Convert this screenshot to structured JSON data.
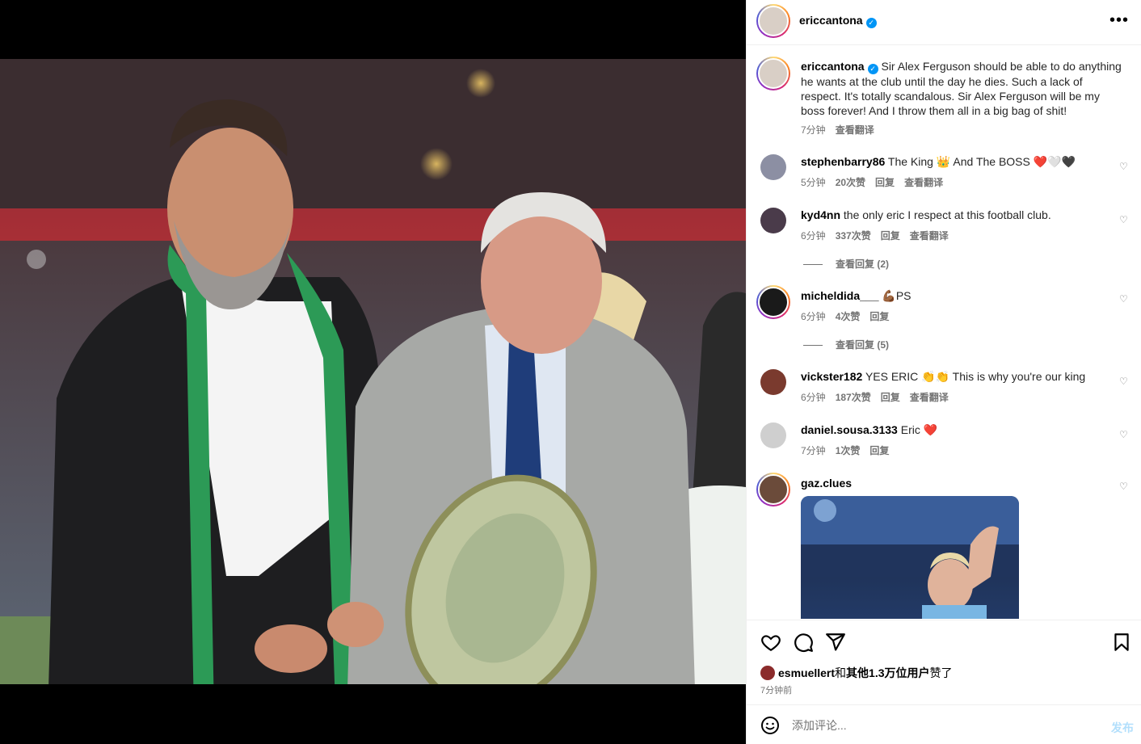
{
  "header": {
    "username": "ericcantona",
    "more_label": "•••"
  },
  "caption": {
    "username": "ericcantona",
    "text": "Sir Alex Ferguson should be able to do anything he wants at the club until the day he dies. Such a lack of respect. It's totally scandalous. Sir Alex Ferguson will be my boss forever! And I throw them all in a big bag of shit!",
    "time": "7分钟",
    "translate": "查看翻译"
  },
  "comments": [
    {
      "username": "stephenbarry86",
      "text": "The King 👑 And The BOSS ❤️🤍🖤",
      "time": "5分钟",
      "likes": "20次赞",
      "reply": "回复",
      "translate": "查看翻译"
    },
    {
      "username": "kyd4nn",
      "text": "the only eric I respect at this football club.",
      "time": "6分钟",
      "likes": "337次赞",
      "reply": "回复",
      "translate": "查看翻译",
      "view_replies": "查看回复 (2)"
    },
    {
      "username": "micheldida___",
      "text": "💪🏾PS",
      "time": "6分钟",
      "likes": "4次赞",
      "reply": "回复",
      "view_replies": "查看回复 (5)"
    },
    {
      "username": "vickster182",
      "text": "YES ERIC 👏👏 This is why you're our king",
      "time": "6分钟",
      "likes": "187次赞",
      "reply": "回复",
      "translate": "查看翻译"
    },
    {
      "username": "daniel.sousa.3133",
      "text": "Eric ❤️",
      "time": "7分钟",
      "likes": "1次赞",
      "reply": "回复"
    },
    {
      "username": "gaz.clues",
      "text": ""
    }
  ],
  "likes_line": {
    "user": "esmuellert",
    "and": "和",
    "others": "其他1.3万位用户",
    "suffix": "赞了"
  },
  "post_time": "7分钟前",
  "comment_box": {
    "placeholder": "添加评论...",
    "post_label": "发布"
  },
  "icons": {
    "like": "heart-icon",
    "comment": "comment-icon",
    "share": "share-icon",
    "save": "bookmark-icon",
    "emoji": "emoji-icon",
    "verified": "verified-badge-icon"
  },
  "colors": {
    "verified": "#0095f6",
    "muted": "#737373",
    "post_button": "#b2dffc"
  }
}
